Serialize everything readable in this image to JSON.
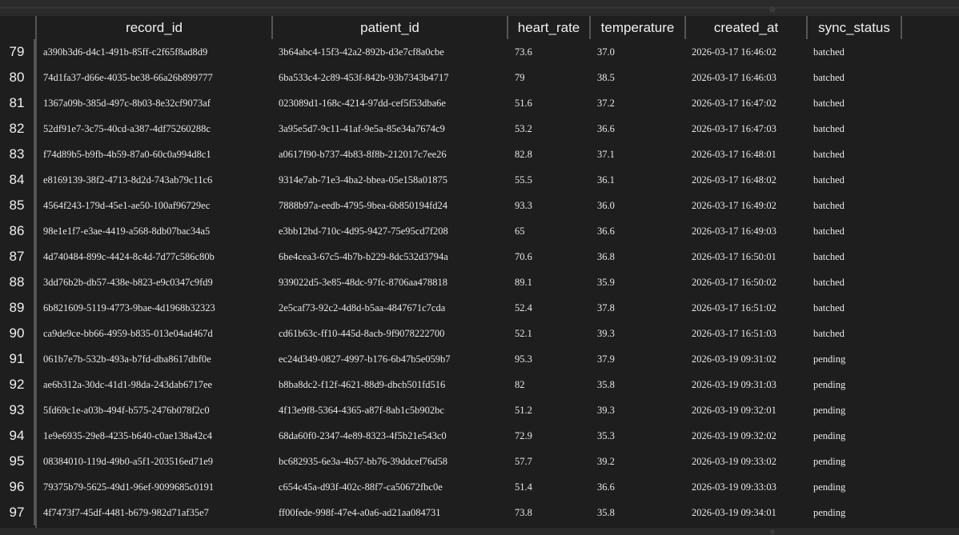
{
  "table": {
    "columns": [
      "record_id",
      "patient_id",
      "heart_rate",
      "temperature",
      "created_at",
      "sync_status"
    ],
    "rows": [
      {
        "n": "79",
        "record_id": "a390b3d6-d4c1-491b-85ff-c2f65f8ad8d9",
        "patient_id": "3b64abc4-15f3-42a2-892b-d3e7cf8a0cbe",
        "heart_rate": "73.6",
        "temperature": "37.0",
        "created_at": "2026-03-17 16:46:02",
        "sync_status": "batched"
      },
      {
        "n": "80",
        "record_id": "74d1fa37-d66e-4035-be38-66a26b899777",
        "patient_id": "6ba533c4-2c89-453f-842b-93b7343b4717",
        "heart_rate": "79",
        "temperature": "38.5",
        "created_at": "2026-03-17 16:46:03",
        "sync_status": "batched"
      },
      {
        "n": "81",
        "record_id": "1367a09b-385d-497c-8b03-8e32cf9073af",
        "patient_id": "023089d1-168c-4214-97dd-cef5f53dba6e",
        "heart_rate": "51.6",
        "temperature": "37.2",
        "created_at": "2026-03-17 16:47:02",
        "sync_status": "batched"
      },
      {
        "n": "82",
        "record_id": "52df91e7-3c75-40cd-a387-4df75260288c",
        "patient_id": "3a95e5d7-9c11-41af-9e5a-85e34a7674c9",
        "heart_rate": "53.2",
        "temperature": "36.6",
        "created_at": "2026-03-17 16:47:03",
        "sync_status": "batched"
      },
      {
        "n": "83",
        "record_id": "f74d89b5-b9fb-4b59-87a0-60c0a994d8c1",
        "patient_id": "a0617f90-b737-4b83-8f8b-212017c7ee26",
        "heart_rate": "82.8",
        "temperature": "37.1",
        "created_at": "2026-03-17 16:48:01",
        "sync_status": "batched"
      },
      {
        "n": "84",
        "record_id": "e8169139-38f2-4713-8d2d-743ab79c11c6",
        "patient_id": "9314e7ab-71e3-4ba2-bbea-05e158a01875",
        "heart_rate": "55.5",
        "temperature": "36.1",
        "created_at": "2026-03-17 16:48:02",
        "sync_status": "batched"
      },
      {
        "n": "85",
        "record_id": "4564f243-179d-45e1-ae50-100af96729ec",
        "patient_id": "7888b97a-eedb-4795-9bea-6b850194fd24",
        "heart_rate": "93.3",
        "temperature": "36.0",
        "created_at": "2026-03-17 16:49:02",
        "sync_status": "batched"
      },
      {
        "n": "86",
        "record_id": "98e1e1f7-e3ae-4419-a568-8db07bac34a5",
        "patient_id": "e3bb12bd-710c-4d95-9427-75e95cd7f208",
        "heart_rate": "65",
        "temperature": "36.6",
        "created_at": "2026-03-17 16:49:03",
        "sync_status": "batched"
      },
      {
        "n": "87",
        "record_id": "4d740484-899c-4424-8c4d-7d77c586c80b",
        "patient_id": "6be4cea3-67c5-4b7b-b229-8dc532d3794a",
        "heart_rate": "70.6",
        "temperature": "36.8",
        "created_at": "2026-03-17 16:50:01",
        "sync_status": "batched"
      },
      {
        "n": "88",
        "record_id": "3dd76b2b-db57-438e-b823-e9c0347c9fd9",
        "patient_id": "939022d5-3e85-48dc-97fc-8706aa478818",
        "heart_rate": "89.1",
        "temperature": "35.9",
        "created_at": "2026-03-17 16:50:02",
        "sync_status": "batched"
      },
      {
        "n": "89",
        "record_id": "6b821609-5119-4773-9bae-4d1968b32323",
        "patient_id": "2e5caf73-92c2-4d8d-b5aa-4847671c7cda",
        "heart_rate": "52.4",
        "temperature": "37.8",
        "created_at": "2026-03-17 16:51:02",
        "sync_status": "batched"
      },
      {
        "n": "90",
        "record_id": "ca9de9ce-bb66-4959-b835-013e04ad467d",
        "patient_id": "cd61b63c-ff10-445d-8acb-9f9078222700",
        "heart_rate": "52.1",
        "temperature": "39.3",
        "created_at": "2026-03-17 16:51:03",
        "sync_status": "batched"
      },
      {
        "n": "91",
        "record_id": "061b7e7b-532b-493a-b7fd-dba8617dbf0e",
        "patient_id": "ec24d349-0827-4997-b176-6b47b5e059b7",
        "heart_rate": "95.3",
        "temperature": "37.9",
        "created_at": "2026-03-19 09:31:02",
        "sync_status": "pending"
      },
      {
        "n": "92",
        "record_id": "ae6b312a-30dc-41d1-98da-243dab6717ee",
        "patient_id": "b8ba8dc2-f12f-4621-88d9-dbcb501fd516",
        "heart_rate": "82",
        "temperature": "35.8",
        "created_at": "2026-03-19 09:31:03",
        "sync_status": "pending"
      },
      {
        "n": "93",
        "record_id": "5fd69c1e-a03b-494f-b575-2476b078f2c0",
        "patient_id": "4f13e9f8-5364-4365-a87f-8ab1c5b902bc",
        "heart_rate": "51.2",
        "temperature": "39.3",
        "created_at": "2026-03-19 09:32:01",
        "sync_status": "pending"
      },
      {
        "n": "94",
        "record_id": "1e9e6935-29e8-4235-b640-c0ae138a42c4",
        "patient_id": "68da60f0-2347-4e89-8323-4f5b21e543c0",
        "heart_rate": "72.9",
        "temperature": "35.3",
        "created_at": "2026-03-19 09:32:02",
        "sync_status": "pending"
      },
      {
        "n": "95",
        "record_id": "08384010-119d-49b0-a5f1-203516ed71e9",
        "patient_id": "bc682935-6e3a-4b57-bb76-39ddcef76d58",
        "heart_rate": "57.7",
        "temperature": "39.2",
        "created_at": "2026-03-19 09:33:02",
        "sync_status": "pending"
      },
      {
        "n": "96",
        "record_id": "79375b79-5625-49d1-96ef-9099685c0191",
        "patient_id": "c654c45a-d93f-402c-88f7-ca50672fbc0e",
        "heart_rate": "51.4",
        "temperature": "36.6",
        "created_at": "2026-03-19 09:33:03",
        "sync_status": "pending"
      },
      {
        "n": "97",
        "record_id": "4f7473f7-45df-4481-b679-982d71af35e7",
        "patient_id": "ff00fede-998f-47e4-a0a6-ad21aa084731",
        "heart_rate": "73.8",
        "temperature": "35.8",
        "created_at": "2026-03-19 09:34:01",
        "sync_status": "pending"
      }
    ]
  }
}
